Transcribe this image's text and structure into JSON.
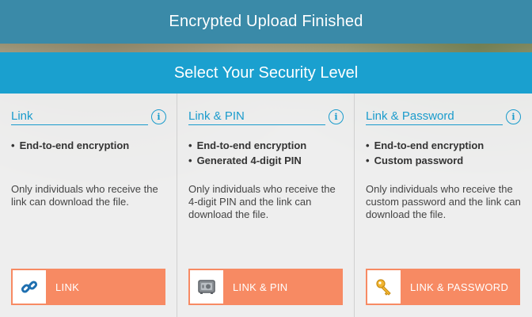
{
  "header": {
    "title": "Encrypted Upload Finished"
  },
  "section": {
    "title": "Select Your Security Level"
  },
  "cards": [
    {
      "title": "Link",
      "info_icon": "i",
      "features": [
        "End-to-end encryption"
      ],
      "description": "Only individuals who receive the link can download the file.",
      "button_label": "LINK",
      "button_icon": "link-icon"
    },
    {
      "title": "Link & PIN",
      "info_icon": "i",
      "features": [
        "End-to-end encryption",
        "Generated 4-digit PIN"
      ],
      "description": "Only individuals who receive the 4-digit PIN and the link can download the file.",
      "button_label": "LINK & PIN",
      "button_icon": "safe-icon"
    },
    {
      "title": "Link & Password",
      "info_icon": "i",
      "features": [
        "End-to-end encryption",
        "Custom password"
      ],
      "description": "Only individuals who receive the custom password and the link can download the file.",
      "button_label": "LINK & PASSWORD",
      "button_icon": "key-icon"
    }
  ],
  "colors": {
    "header_bg": "#3a8aa8",
    "section_bg": "#1aa0cf",
    "accent": "#1a9bcc",
    "button_bg": "#f78a63"
  }
}
